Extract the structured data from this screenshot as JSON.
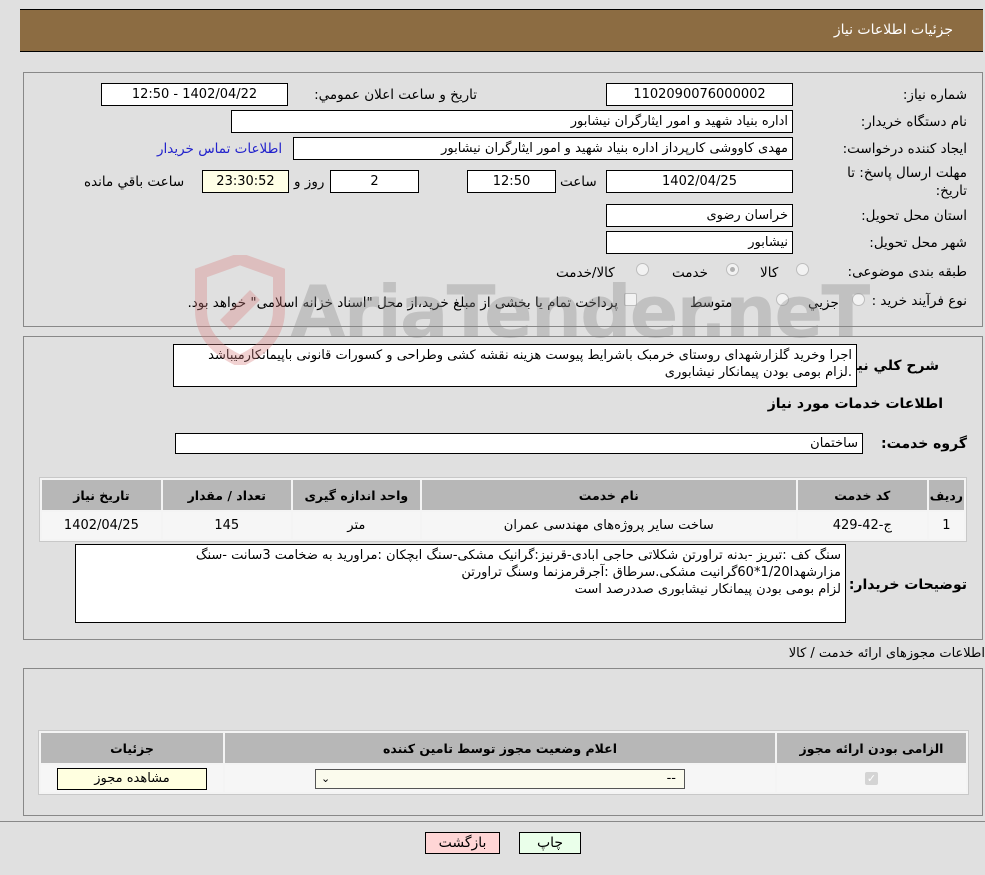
{
  "header": {
    "title": "جزئیات اطلاعات نیاز"
  },
  "need_info": {
    "need_number_label": "شماره نیاز:",
    "need_number": "1102090076000002",
    "announce_label": "تاریخ و ساعت اعلان عمومي:",
    "announce_value": "1402/04/22 - 12:50",
    "buyer_org_label": "نام دستگاه خریدار:",
    "buyer_org": "اداره بنیاد شهید و امور ایثارگران نیشابور",
    "creator_label": "ایجاد کننده درخواست:",
    "creator": "مهدی کاووشی کارپرداز اداره بنیاد شهید و امور ایثارگران نیشابور",
    "contact_link": "اطلاعات تماس خریدار",
    "deadline_label_1": "مهلت ارسال پاسخ: تا",
    "deadline_label_2": "تاریخ:",
    "deadline_date": "1402/04/25",
    "time_label": "ساعت",
    "deadline_time": "12:50",
    "days_value": "2",
    "days_label": "روز و",
    "remaining_time": "23:30:52",
    "remaining_label": "ساعت باقي مانده",
    "province_label": "استان محل تحویل:",
    "province": "خراسان رضوی",
    "city_label": "شهر محل تحویل:",
    "city": "نیشابور",
    "category_label": "طبقه بندی موضوعی:",
    "category_options": [
      "کالا",
      "خدمت",
      "کالا/خدمت"
    ],
    "category_selected": "خدمت",
    "process_label": "نوع فرآیند خرید :",
    "process_options": [
      "جزيي",
      "متوسط"
    ],
    "treasury_note": "پرداخت تمام یا بخشی از مبلغ خرید،از محل \"اسناد خزانه اسلامی\" خواهد بود."
  },
  "summary": {
    "label": "شرح کلي نیاز:",
    "text": "اجرا وخرید گلزارشهدای روستای خرمبک باشرایط پیوست هزینه نقشه کشی وطراحی و کسورات قانونی باپیمانکارمیباشد .لزام بومی بودن پیمانکار نیشابوری"
  },
  "services": {
    "title": "اطلاعات خدمات مورد نیاز",
    "group_label": "گروه خدمت:",
    "group_value": "ساختمان",
    "columns": [
      "ردیف",
      "کد خدمت",
      "نام خدمت",
      "واحد اندازه گیری",
      "تعداد / مقدار",
      "تاریخ نیاز"
    ],
    "rows": [
      [
        "1",
        "ج-42-429",
        "ساخت سایر پروژه‌های مهندسی عمران",
        "متر",
        "145",
        "1402/04/25"
      ]
    ]
  },
  "buyer_notes": {
    "label": "توضیحات خریدار:",
    "text": "سنگ کف :تبریز -بدنه تراورتن شکلاتی حاجی ابادی-قرنیز:گرانیک مشکی-سنگ ابچکان :مراورید به ضخامت 3سانت -سنگ مزارشهدا1/20*60گرانیت مشکی.سرطاق :آجرقرمزنما وسنگ تراورتن\nلزام بومی بودن پیمانکار نیشابوری صددرصد است"
  },
  "permits": {
    "title": "اطلاعات مجوزهای ارائه خدمت / کالا",
    "columns": [
      "الزامی بودن ارائه مجوز",
      "اعلام وضعیت مجوز توسط تامین کننده",
      "جزئیات"
    ],
    "row": {
      "required_checked": true,
      "status_value": "--",
      "details_button": "مشاهده مجوز"
    }
  },
  "footer": {
    "print_button": "چاپ",
    "back_button": "بازگشت"
  },
  "watermark": {
    "text": "AriaTender.neT"
  },
  "colors": {
    "header_bg": "#8c6c42",
    "print_bg": "#eaffea",
    "back_bg": "#ffd6d6",
    "link": "#2222cc"
  }
}
